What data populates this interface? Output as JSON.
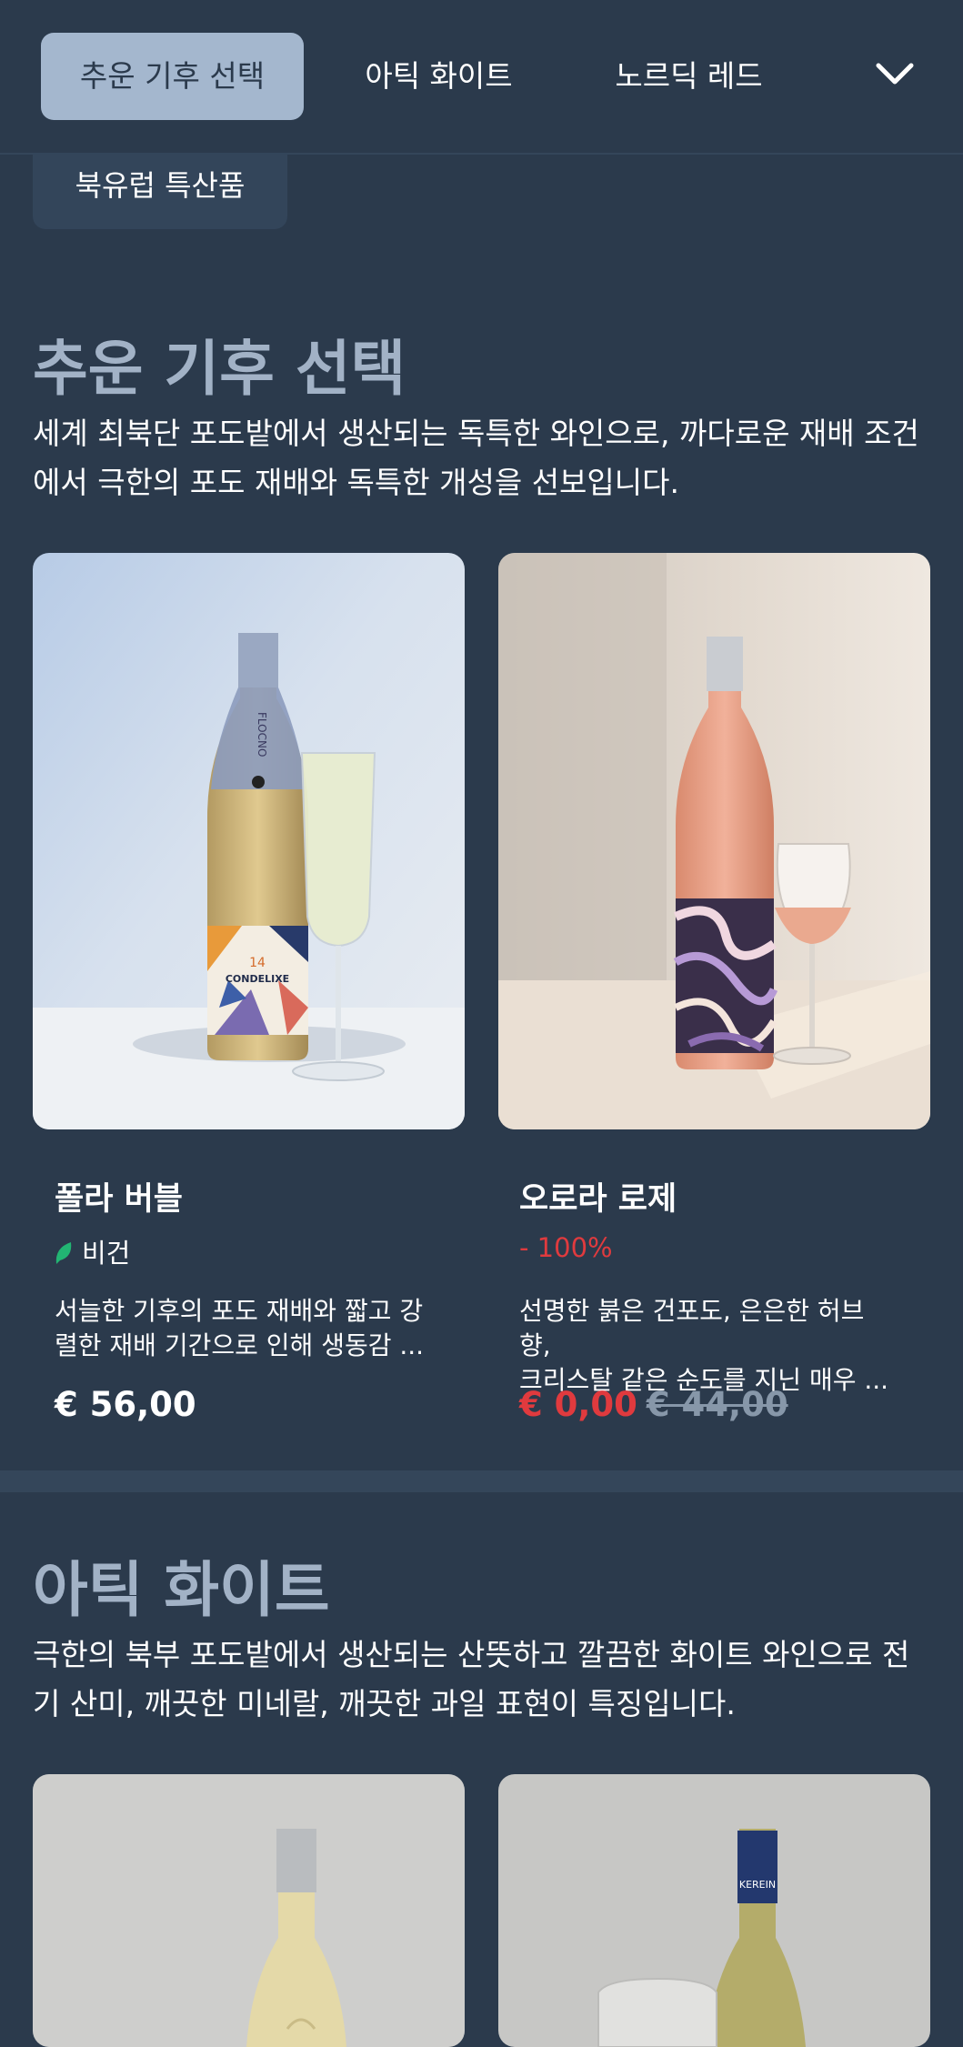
{
  "nav": {
    "tabs": [
      "추운 기후 선택",
      "아틱 화이트",
      "노르딕 레드"
    ],
    "extra_tab": "북유럽 특산품",
    "expand_icon": "chevron-down-icon"
  },
  "sections": [
    {
      "title": "추운 기후 선택",
      "description": "세계 최북단 포도밭에서 생산되는 독특한 와인으로, 까다로운 재배 조건에서 극한의 포도 재배와 독특한 개성을 선보입니다.",
      "products": [
        {
          "name": "폴라 버블",
          "badge": "비건",
          "badge_icon": "leaf-icon",
          "description": "서늘한 기후의 포도 재배와 짧고 강\n렬한 재배 기간으로 인해 생동감 ...",
          "price": "€ 56,00",
          "bottle_label": "CONDELIXE",
          "bottle_neck": "FLOCNO",
          "bottle_number": "14"
        },
        {
          "name": "오로라 로제",
          "discount": "- 100%",
          "description": "선명한 붉은 건포도, 은은한 허브 향,\n크리스탈 같은 순도를 지닌 매우 ...",
          "sale_price": "€ 0,00",
          "original_price": "€ 44,00"
        }
      ]
    },
    {
      "title": "아틱 화이트",
      "description": "극한의 북부 포도밭에서 생산되는 산뜻하고 깔끔한 화이트 와인으로 전기 산미, 깨끗한 미네랄, 깨끗한 과일 표현이 특징입니다.",
      "products": [
        {
          "bottle_label": ""
        },
        {
          "bottle_label": "KEREIN"
        }
      ]
    }
  ],
  "colors": {
    "background": "#2b3a4c",
    "active_tab": "#a4b7ce",
    "section_title": "#a2b2c6",
    "sale": "#e03a3e",
    "vegan_leaf": "#22b573"
  }
}
